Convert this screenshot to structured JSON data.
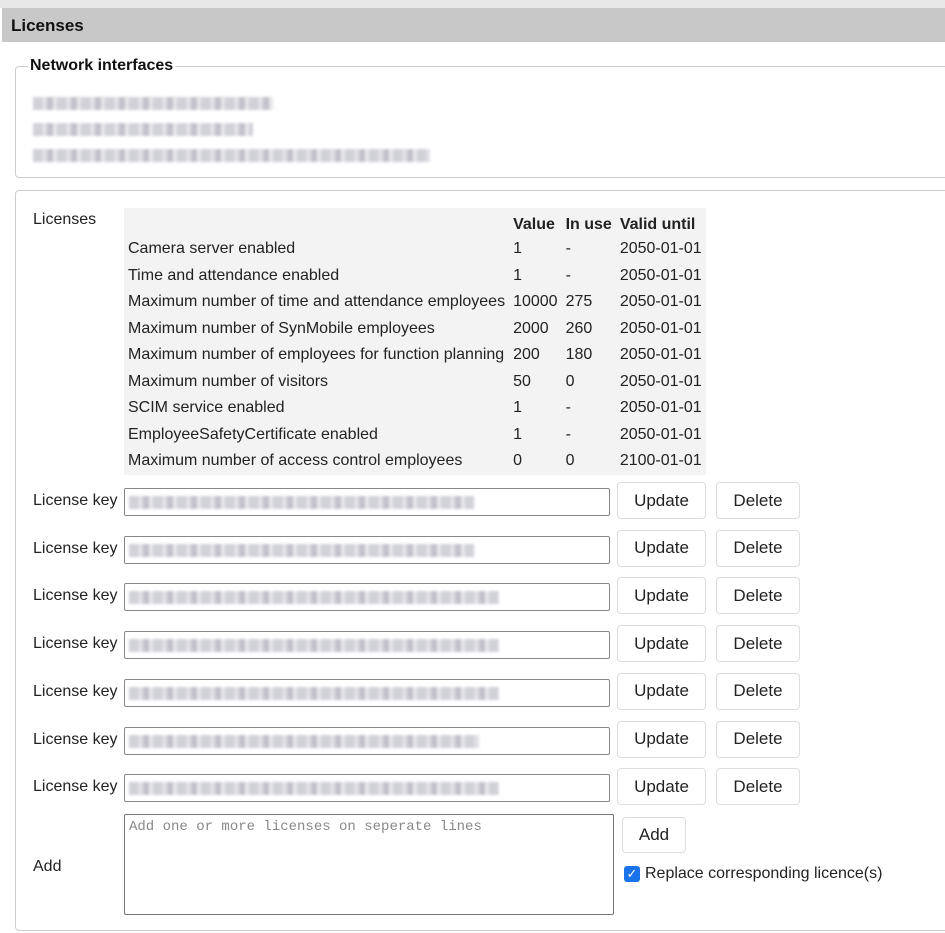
{
  "header": {
    "title": "Licenses"
  },
  "network": {
    "legend": "Network interfaces"
  },
  "licenses": {
    "label": "Licenses",
    "columns": [
      "",
      "Value",
      "In use",
      "Valid until"
    ],
    "rows": [
      [
        "Camera server enabled",
        "1",
        "-",
        "2050-01-01"
      ],
      [
        "Time and attendance enabled",
        "1",
        "-",
        "2050-01-01"
      ],
      [
        "Maximum number of time and attendance employees",
        "10000",
        "275",
        "2050-01-01"
      ],
      [
        "Maximum number of SynMobile employees",
        "2000",
        "260",
        "2050-01-01"
      ],
      [
        "Maximum number of employees for function planning",
        "200",
        "180",
        "2050-01-01"
      ],
      [
        "Maximum number of visitors",
        "50",
        "0",
        "2050-01-01"
      ],
      [
        "SCIM service enabled",
        "1",
        "-",
        "2050-01-01"
      ],
      [
        "EmployeeSafetyCertificate enabled",
        "1",
        "-",
        "2050-01-01"
      ],
      [
        "Maximum number of access control employees",
        "0",
        "0",
        "2100-01-01"
      ]
    ]
  },
  "keys": {
    "label": "License key",
    "update": "Update",
    "delete": "Delete",
    "count": 7
  },
  "add": {
    "label": "Add",
    "placeholder": "Add one or more licenses on seperate lines",
    "button": "Add",
    "replace_label": "Replace corresponding licence(s)",
    "replace_checked": true
  }
}
